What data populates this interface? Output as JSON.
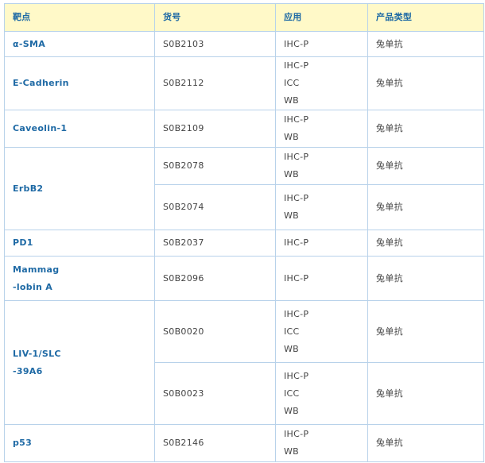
{
  "headers": [
    "靶点",
    "货号",
    "应用",
    "产品类型"
  ],
  "groups": [
    {
      "target": [
        "α-SMA"
      ],
      "rows": [
        {
          "cat": "S0B2103",
          "apps": [
            "IHC-P"
          ],
          "ptype": "兔单抗"
        }
      ]
    },
    {
      "target": [
        "E-Cadherin"
      ],
      "rows": [
        {
          "cat": "S0B2112",
          "apps": [
            "IHC-P",
            "ICC",
            "WB"
          ],
          "ptype": "兔单抗"
        }
      ]
    },
    {
      "target": [
        "Caveolin-1"
      ],
      "rows": [
        {
          "cat": "S0B2109",
          "apps": [
            "IHC-P",
            "WB"
          ],
          "ptype": "兔单抗"
        }
      ]
    },
    {
      "target": [
        "ErbB2"
      ],
      "rows": [
        {
          "cat": "S0B2078",
          "apps": [
            "IHC-P",
            "WB"
          ],
          "ptype": "兔单抗"
        },
        {
          "cat": "S0B2074",
          "apps": [
            "IHC-P",
            "WB"
          ],
          "ptype": "兔单抗"
        }
      ]
    },
    {
      "target": [
        "PD1"
      ],
      "rows": [
        {
          "cat": "S0B2037",
          "apps": [
            "IHC-P"
          ],
          "ptype": "兔单抗"
        }
      ]
    },
    {
      "target": [
        "Mammag",
        "-lobin A"
      ],
      "rows": [
        {
          "cat": "S0B2096",
          "apps": [
            "IHC-P"
          ],
          "ptype": "兔单抗"
        }
      ]
    },
    {
      "target": [
        "LIV-1/SLC",
        "-39A6"
      ],
      "rows": [
        {
          "cat": "S0B0020",
          "apps": [
            "IHC-P",
            "ICC",
            "WB"
          ],
          "ptype": "兔单抗"
        },
        {
          "cat": "S0B0023",
          "apps": [
            "IHC-P",
            "ICC",
            "WB"
          ],
          "ptype": "兔单抗"
        }
      ]
    },
    {
      "target": [
        "p53"
      ],
      "rows": [
        {
          "cat": "S0B2146",
          "apps": [
            "IHC-P",
            "WB"
          ],
          "ptype": "兔单抗"
        }
      ]
    }
  ]
}
